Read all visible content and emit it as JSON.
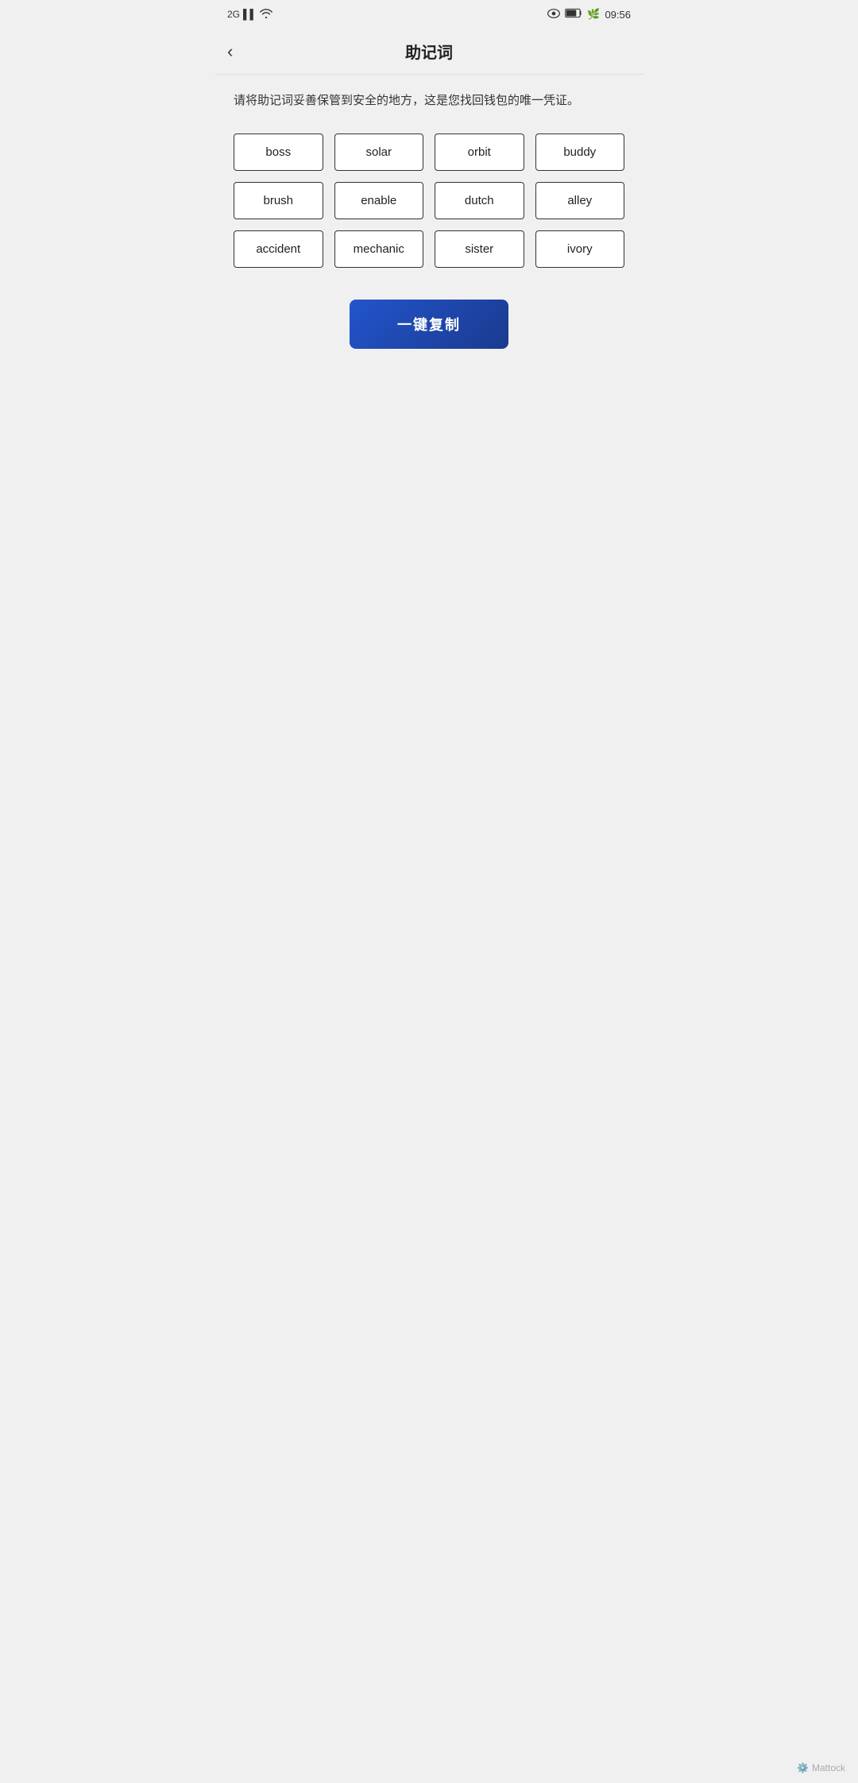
{
  "statusBar": {
    "left": {
      "signal": "2G",
      "bars": "▌▌▌",
      "wifi": "wifi"
    },
    "right": {
      "eye": "👁",
      "battery": "76",
      "leaf": "🌿",
      "time": "09:56"
    }
  },
  "navBar": {
    "backIcon": "‹",
    "title": "助记词"
  },
  "description": "请将助记词妥善保管到安全的地方，这是您找回钱包的唯一凭证。",
  "words": [
    "boss",
    "solar",
    "orbit",
    "buddy",
    "brush",
    "enable",
    "dutch",
    "alley",
    "accident",
    "mechanic",
    "sister",
    "ivory"
  ],
  "copyButton": {
    "label": "一键复制"
  },
  "footer": {
    "brand": "Mattock"
  }
}
